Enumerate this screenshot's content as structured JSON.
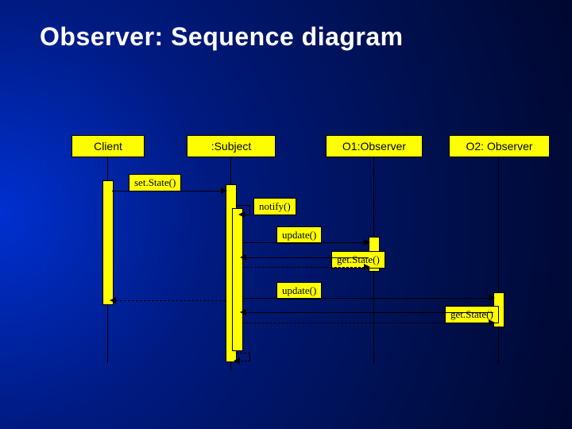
{
  "title": "Observer: Sequence diagram",
  "participants": {
    "client": {
      "label": "Client"
    },
    "subject": {
      "label": ":Subject"
    },
    "o1": {
      "label": "O1:Observer"
    },
    "o2": {
      "label": "O2: Observer"
    }
  },
  "messages": {
    "setState": {
      "label": "set.State()"
    },
    "notify": {
      "label": "notify()"
    },
    "update1": {
      "label": "update()"
    },
    "getState1": {
      "label": "get.State()"
    },
    "update2": {
      "label": "update()"
    },
    "getState2": {
      "label": "get.State()"
    }
  },
  "chart_data": {
    "type": "sequence-diagram",
    "title": "Observer: Sequence diagram",
    "participants": [
      "Client",
      ":Subject",
      "O1:Observer",
      "O2: Observer"
    ],
    "interactions": [
      {
        "from": "Client",
        "to": ":Subject",
        "call": "setState()",
        "return": true
      },
      {
        "from": ":Subject",
        "to": ":Subject",
        "call": "notify()",
        "self": true
      },
      {
        "from": ":Subject",
        "to": "O1:Observer",
        "call": "update()"
      },
      {
        "from": "O1:Observer",
        "to": ":Subject",
        "call": "getState()",
        "return": true
      },
      {
        "from": ":Subject",
        "to": "O2: Observer",
        "call": "update()"
      },
      {
        "from": "O2: Observer",
        "to": ":Subject",
        "call": "getState()",
        "return": true
      }
    ]
  }
}
